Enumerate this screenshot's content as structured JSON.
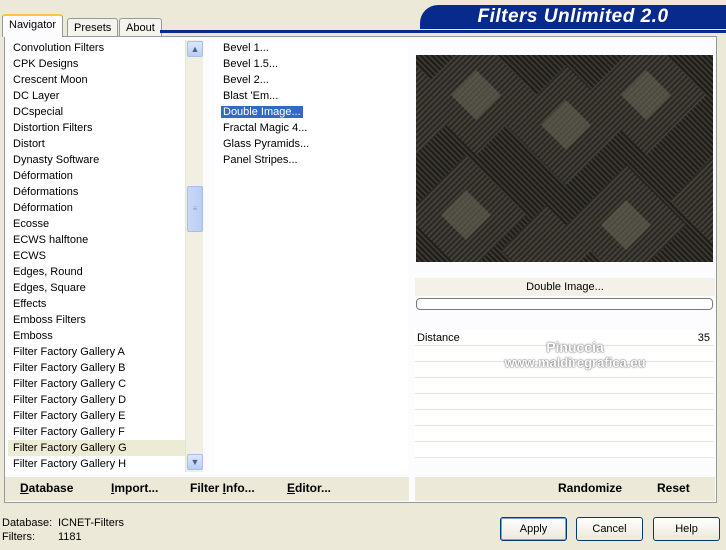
{
  "tabs": [
    "Navigator",
    "Presets",
    "About"
  ],
  "header": {
    "title": "Filters Unlimited 2.0"
  },
  "categories": [
    "Convolution Filters",
    "CPK Designs",
    "Crescent Moon",
    "DC Layer",
    "DCspecial",
    "Distortion Filters",
    "Distort",
    "Dynasty Software",
    "Déformation",
    "Déformations",
    "Déformation",
    "Ecosse",
    "ECWS halftone",
    "ECWS",
    "Edges, Round",
    "Edges, Square",
    "Effects",
    "Emboss Filters",
    "Emboss",
    "Filter Factory Gallery A",
    "Filter Factory Gallery B",
    "Filter Factory Gallery C",
    "Filter Factory Gallery D",
    "Filter Factory Gallery E",
    "Filter Factory Gallery F",
    "Filter Factory Gallery G",
    "Filter Factory Gallery H"
  ],
  "selected_category": "Filter Factory Gallery G",
  "filters": [
    "Bevel 1...",
    "Bevel 1.5...",
    "Bevel 2...",
    "Blast 'Em...",
    "Double Image...",
    "Fractal Magic 4...",
    "Glass Pyramids...",
    "Panel Stripes..."
  ],
  "selected_filter": "Double Image...",
  "preview": {
    "label": "Double Image...",
    "progress": 0
  },
  "params": [
    {
      "name": "Distance",
      "value": "35"
    }
  ],
  "watermark": {
    "line1": "Pinuccia",
    "line2": "www.maldiregrafica.eu"
  },
  "bottom_left": [
    {
      "accel": "D",
      "rest": "atabase"
    },
    {
      "accel": "I",
      "rest": "mport..."
    },
    {
      "accel": "",
      "pre": "Filter ",
      "accel2": "I",
      "rest": "nfo..."
    },
    {
      "accel": "E",
      "rest": "ditor..."
    }
  ],
  "bottom_right": [
    "Randomize",
    "Reset"
  ],
  "status": {
    "database_label": "Database:",
    "database_value": "ICNET-Filters",
    "filters_label": "Filters:",
    "filters_value": "1181"
  },
  "buttons": [
    "Apply",
    "Cancel",
    "Help"
  ],
  "colors": {
    "banner": "#082a8c",
    "selection": "#316ac5",
    "window": "#ece9d8"
  }
}
